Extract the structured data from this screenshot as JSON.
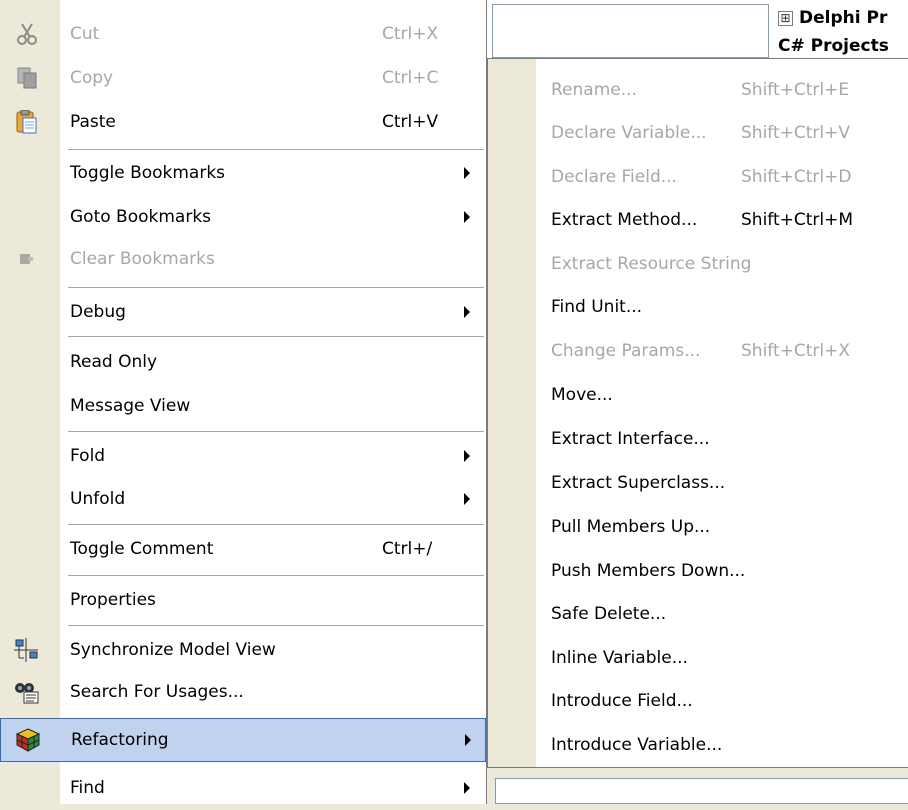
{
  "background": {
    "tree_item_1": "Delphi Pr",
    "tree_item_2": "C# Projects",
    "tree_expand_glyph": "⊞"
  },
  "main_menu": {
    "items": [
      {
        "label": "Cut",
        "shortcut": "Ctrl+X",
        "enabled": false,
        "icon": "scissors-icon"
      },
      {
        "label": "Copy",
        "shortcut": "Ctrl+C",
        "enabled": false,
        "icon": "copy-icon"
      },
      {
        "label": "Paste",
        "shortcut": "Ctrl+V",
        "enabled": true,
        "icon": "paste-icon"
      },
      {
        "label": "Toggle Bookmarks",
        "submenu": true,
        "enabled": true
      },
      {
        "label": "Goto Bookmarks",
        "submenu": true,
        "enabled": true
      },
      {
        "label": "Clear Bookmarks",
        "enabled": false,
        "icon": "bookmark-clear-icon"
      },
      {
        "label": "Debug",
        "submenu": true,
        "enabled": true
      },
      {
        "label": "Read Only",
        "enabled": true
      },
      {
        "label": "Message View",
        "enabled": true
      },
      {
        "label": "Fold",
        "submenu": true,
        "enabled": true
      },
      {
        "label": "Unfold",
        "submenu": true,
        "enabled": true
      },
      {
        "label": "Toggle Comment",
        "shortcut": "Ctrl+/",
        "enabled": true
      },
      {
        "label": "Properties",
        "enabled": true
      },
      {
        "label": "Synchronize Model View",
        "enabled": true,
        "icon": "sync-model-icon"
      },
      {
        "label": "Search For Usages...",
        "enabled": true,
        "icon": "binoculars-icon"
      },
      {
        "label": "Refactoring",
        "submenu": true,
        "enabled": true,
        "selected": true,
        "icon": "refactoring-cube-icon"
      },
      {
        "label": "Find",
        "submenu": true,
        "enabled": true
      }
    ]
  },
  "refactoring_submenu": {
    "items": [
      {
        "label": "Rename...",
        "shortcut": "Shift+Ctrl+E",
        "enabled": false
      },
      {
        "label": "Declare Variable...",
        "shortcut": "Shift+Ctrl+V",
        "enabled": false
      },
      {
        "label": "Declare Field...",
        "shortcut": "Shift+Ctrl+D",
        "enabled": false
      },
      {
        "label": "Extract Method...",
        "shortcut": "Shift+Ctrl+M",
        "enabled": true
      },
      {
        "label": "Extract Resource String",
        "enabled": false
      },
      {
        "label": "Find Unit...",
        "enabled": true
      },
      {
        "label": "Change Params...",
        "shortcut": "Shift+Ctrl+X",
        "enabled": false
      },
      {
        "label": "Move...",
        "enabled": true
      },
      {
        "label": "Extract Interface...",
        "enabled": true
      },
      {
        "label": "Extract Superclass...",
        "enabled": true
      },
      {
        "label": "Pull Members Up...",
        "enabled": true
      },
      {
        "label": "Push Members Down...",
        "enabled": true
      },
      {
        "label": "Safe Delete...",
        "enabled": true
      },
      {
        "label": "Inline Variable...",
        "enabled": true
      },
      {
        "label": "Introduce Field...",
        "enabled": true
      },
      {
        "label": "Introduce Variable...",
        "enabled": true
      }
    ]
  }
}
